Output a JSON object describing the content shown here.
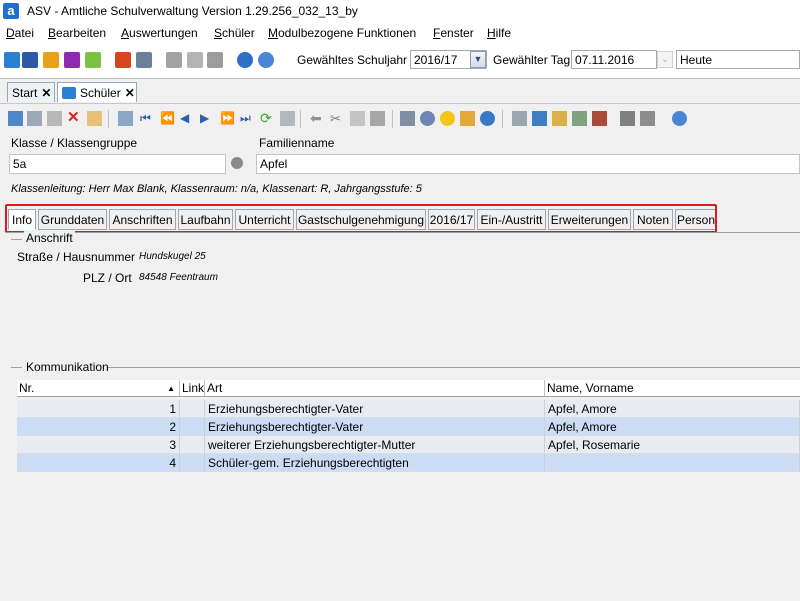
{
  "window": {
    "title": "ASV - Amtliche Schulverwaltung Version 1.29.256_032_13_by",
    "app_icon": "a"
  },
  "menu": [
    "Datei",
    "Bearbeiten",
    "Auswertungen",
    "Schüler",
    "Modulbezogene Funktionen",
    "Fenster",
    "Hilfe"
  ],
  "toolbar": {
    "schuljahr_label": "Gewähltes Schuljahr",
    "schuljahr_value": "2016/17",
    "tag_label": "Gewählter Tag",
    "tag_value": "07.11.2016",
    "heute_value": "Heute"
  },
  "tabs": [
    {
      "label": "Start",
      "close": "✕"
    },
    {
      "label": "Schüler",
      "close": "✕"
    }
  ],
  "form": {
    "klasse_label": "Klasse / Klassengruppe",
    "klasse_value": "5a",
    "familienname_label": "Familienname",
    "familienname_value": "Apfel",
    "info_line": "Klassenleitung: Herr Max Blank, Klassenraum: n/a, Klassenart: R, Jahrgangsstufe: 5"
  },
  "form_tabs": [
    "Info",
    "Grunddaten",
    "Anschriften",
    "Laufbahn",
    "Unterricht",
    "Gastschulgenehmigung",
    "2016/17",
    "Ein-/Austritt",
    "Erweiterungen",
    "Noten",
    "Person"
  ],
  "anschrift": {
    "group_label": "Anschrift",
    "strasse_label": "Straße / Hausnummer",
    "strasse_value": "Hundskugel 25",
    "plz_label": "PLZ / Ort",
    "plz_value": "84548 Feentraum"
  },
  "kommunikation": {
    "group_label": "Kommunikation",
    "columns": [
      "Nr.",
      "Link",
      "Art",
      "Name, Vorname"
    ],
    "rows": [
      {
        "nr": "1",
        "art": "Erziehungsberechtigter-Vater",
        "name": "Apfel, Amore"
      },
      {
        "nr": "2",
        "art": "Erziehungsberechtigter-Vater",
        "name": "Apfel, Amore"
      },
      {
        "nr": "3",
        "art": "weiterer Erziehungsberechtigter-Mutter",
        "name": "Apfel, Rosemarie"
      },
      {
        "nr": "4",
        "art": "Schüler-gem. Erziehungsberechtigten",
        "name": ""
      }
    ]
  },
  "colors": {
    "selected_row": "#cddcf5",
    "plain_row": "#e8ecf2",
    "highlight_frame": "#e0181e",
    "accent": "#1f6fd0"
  }
}
